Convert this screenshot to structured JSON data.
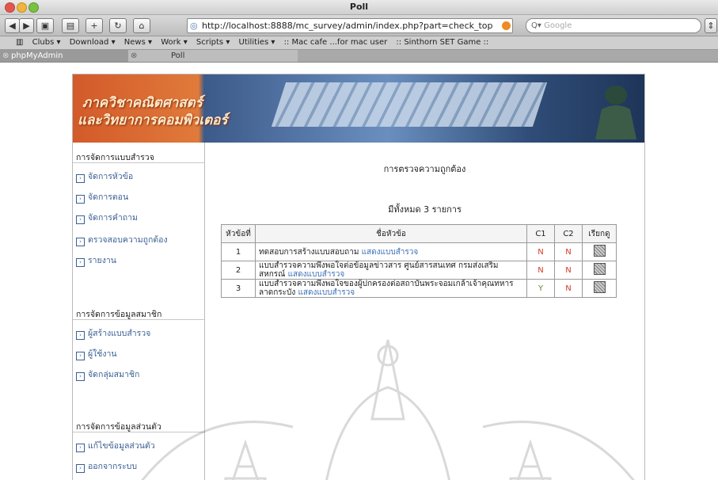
{
  "window": {
    "title": "Poll"
  },
  "toolbar": {
    "url": "http://localhost:8888/mc_survey/admin/index.php?part=check_top",
    "search_placeholder": "Google",
    "back_icon": "back-arrow-icon",
    "forward_icon": "forward-arrow-icon"
  },
  "bookmarks": [
    "Clubs ▾",
    "Download ▾",
    "News ▾",
    "Work ▾",
    "Scripts ▾",
    "Utilities ▾",
    ":: Mac cafe ...for mac user",
    ":: Sinthorn SET Game ::"
  ],
  "tabs": [
    {
      "label": "phpMyAdmin"
    },
    {
      "label": "Poll"
    }
  ],
  "banner": {
    "line1": "ภาควิชาคณิตศาสตร์",
    "line2": "และวิทยาการคอมพิวเตอร์"
  },
  "sidebar": {
    "sections": [
      {
        "title": "การจัดการแบบสำรวจ",
        "items": [
          "จัดการหัวข้อ",
          "จัดการตอน",
          "จัดการคำถาม",
          "ตรวจสอบความถูกต้อง",
          "รายงาน"
        ]
      },
      {
        "title": "การจัดการข้อมูลสมาชิก",
        "items": [
          "ผู้สร้างแบบสำรวจ",
          "ผู้ใช้งาน",
          "จัดกลุ่มสมาชิก"
        ]
      },
      {
        "title": "การจัดการข้อมูลส่วนตัว",
        "items": [
          "แก้ไขข้อมูลส่วนตัว",
          "ออกจากระบบ"
        ]
      }
    ]
  },
  "main": {
    "heading": "การตรวจความถูกต้อง",
    "count_text": "มีทั้งหมด 3 รายการ",
    "table": {
      "headers": [
        "หัวข้อที่",
        "ชื่อหัวข้อ",
        "C1",
        "C2",
        "เรียกดู"
      ],
      "rows": [
        {
          "no": "1",
          "title": "ทดสอบการสร้างแบบสอบถาม",
          "link": "แสดงแบบสำรวจ",
          "c1": "N",
          "c2": "N"
        },
        {
          "no": "2",
          "title": "แบบสำรวจความพึงพอใจต่อข้อมูลข่าวสาร ศูนย์สารสนเทศ กรมส่งเสริมสหกรณ์",
          "link": "แสดงแบบสำรวจ",
          "c1": "N",
          "c2": "N"
        },
        {
          "no": "3",
          "title": "แบบสำรวจความพึงพอใจของผู้ปกครองต่อสถาบันพระจอมเกล้าเจ้าคุณทหารลาดกระบัง",
          "link": "แสดงแบบสำรวจ",
          "c1": "Y",
          "c2": "N"
        }
      ]
    }
  }
}
